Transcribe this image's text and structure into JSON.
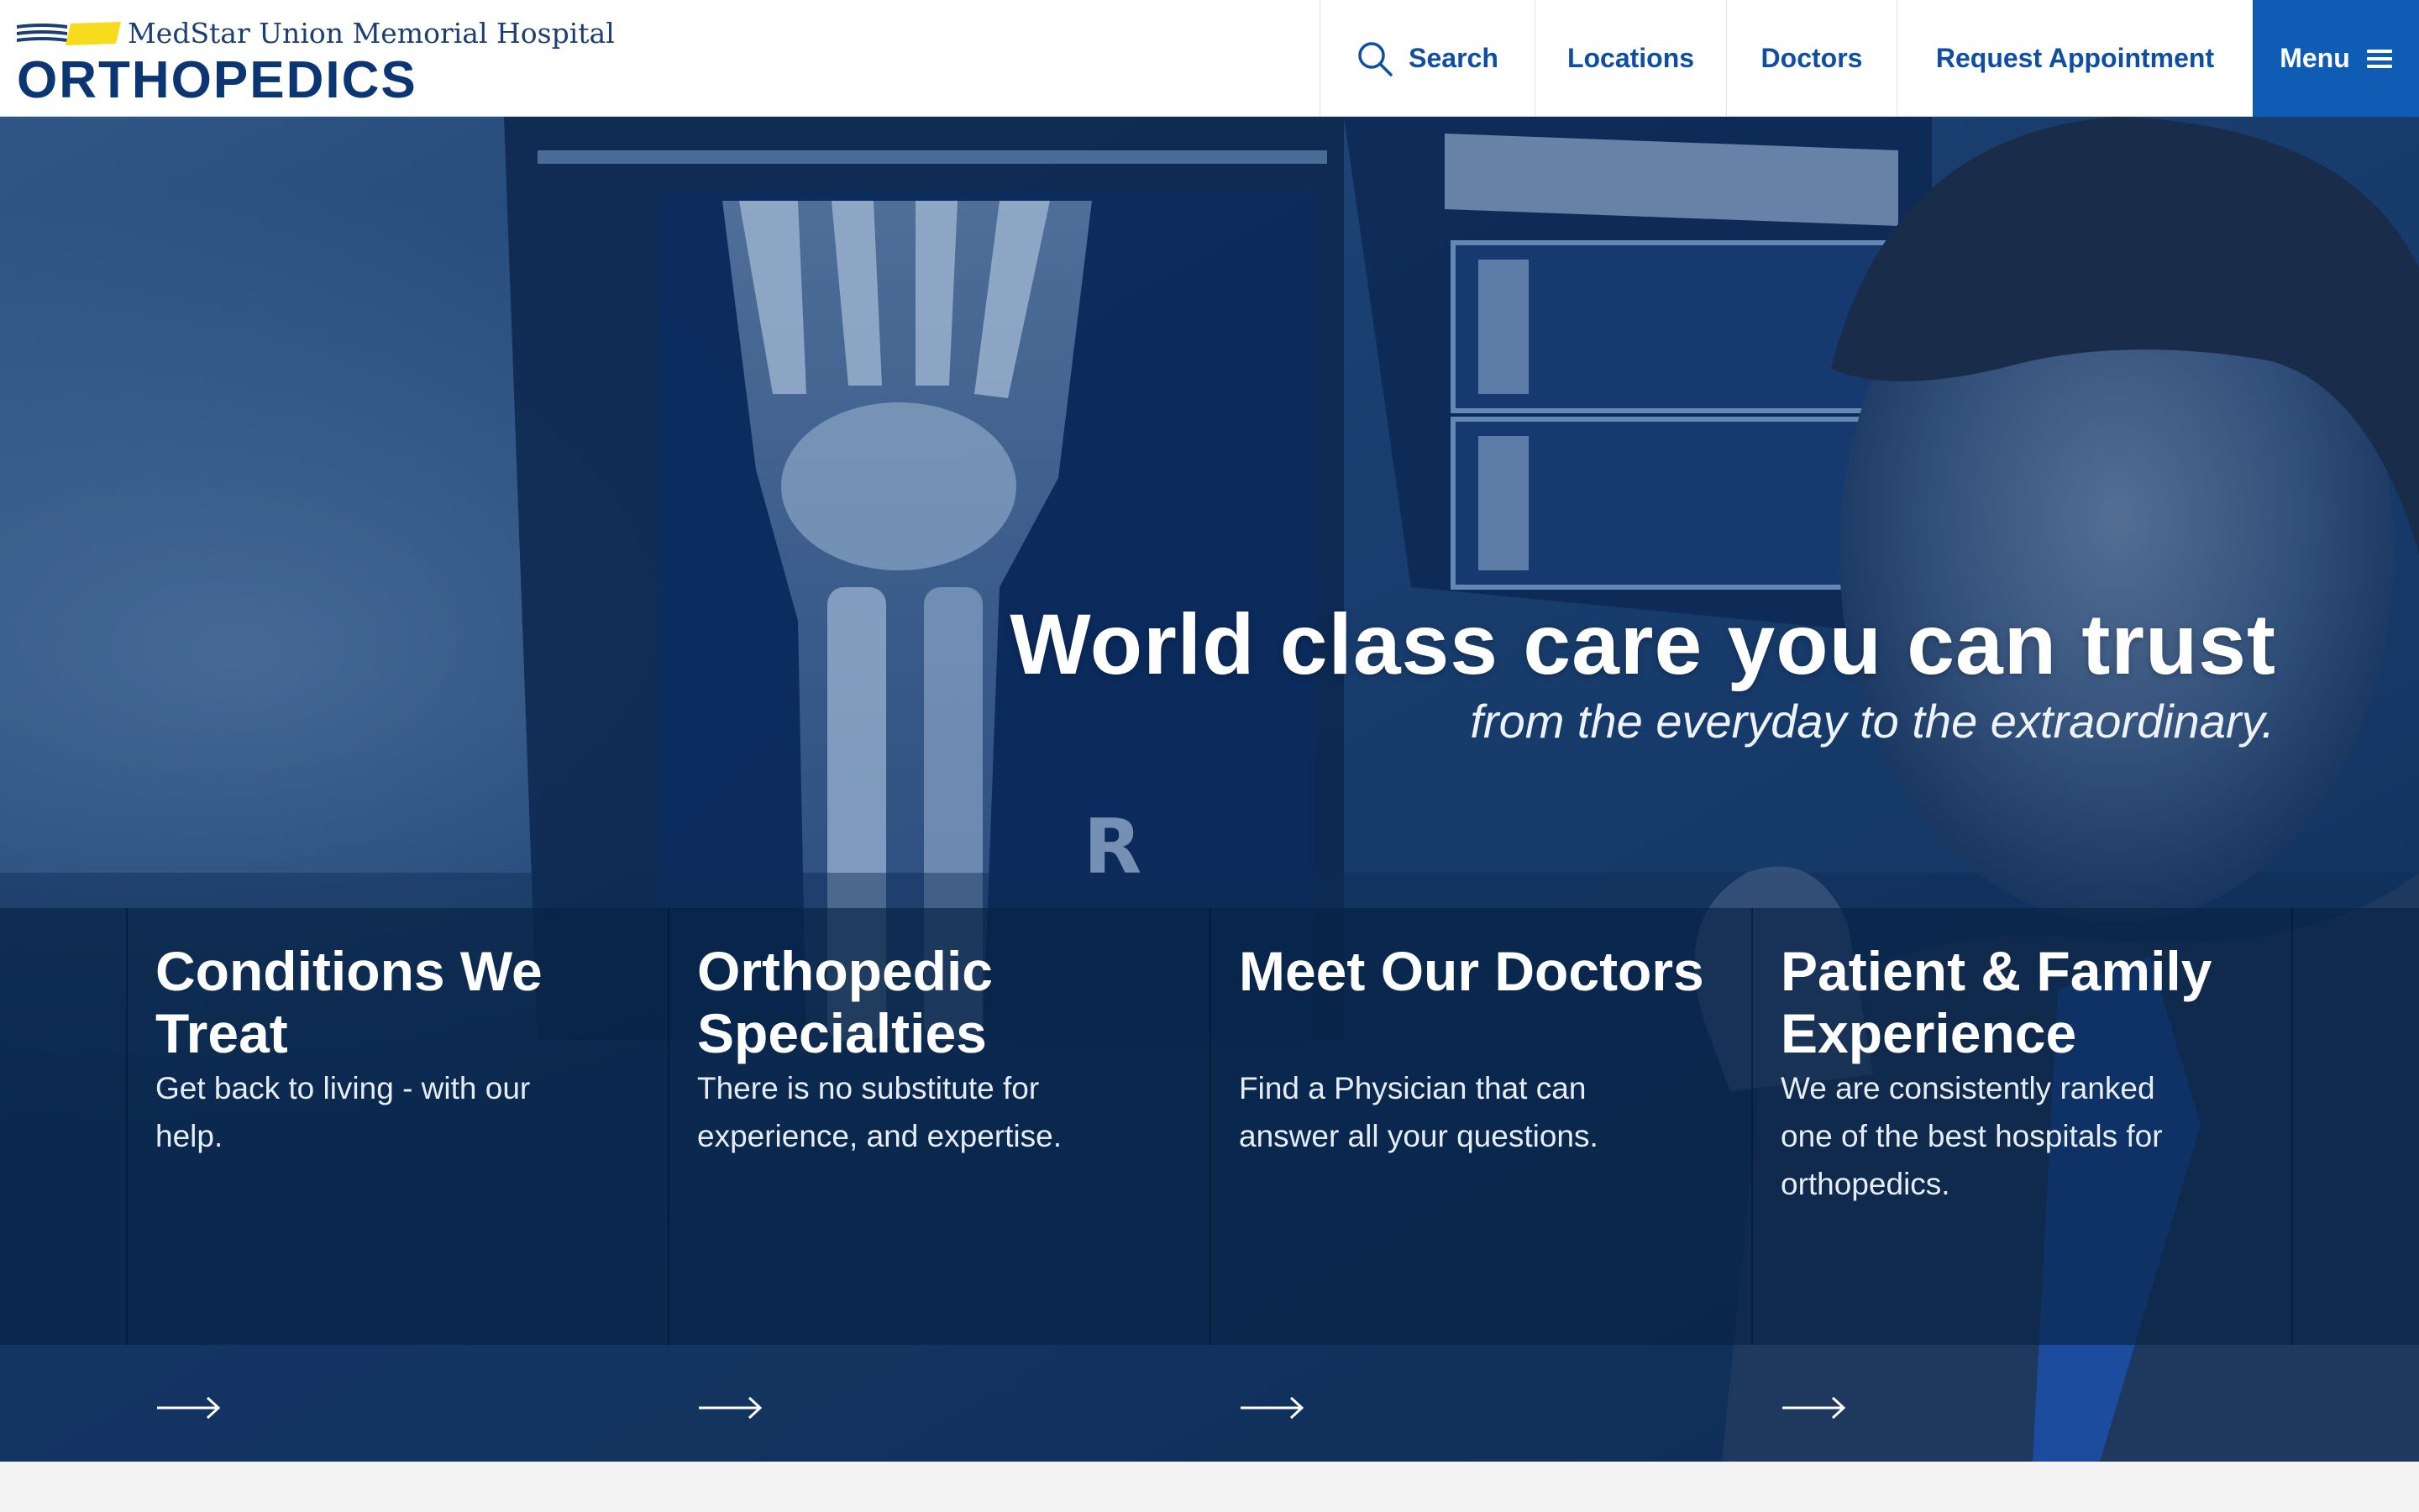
{
  "header": {
    "hospital_name": "MedStar Union Memorial Hospital",
    "department": "ORTHOPEDICS",
    "logo_icon": "medstar-logo-icon"
  },
  "nav": {
    "search_label": "Search",
    "locations_label": "Locations",
    "doctors_label": "Doctors",
    "request_label": "Request Appointment",
    "menu_label": "Menu"
  },
  "hero": {
    "headline": "World class care you can trust",
    "subheadline": "from the everyday to the extraordinary."
  },
  "cards": [
    {
      "title": "Conditions We Treat",
      "description": "Get back to living - with our help."
    },
    {
      "title": "Orthopedic Specialties",
      "description": "There is no substitute for experience, and expertise."
    },
    {
      "title": "Meet Our Doctors",
      "description": "Find a Physician that can answer all your questions."
    },
    {
      "title": "Patient & Family Experience",
      "description": "We are consistently ranked one of the best hospitals for orthopedics."
    }
  ],
  "colors": {
    "brand_navy": "#0b3573",
    "link_blue": "#0e4fa3",
    "menu_blue": "#0e5cb4",
    "accent_yellow": "#f6dc1c",
    "hero_overlay": "#12325c"
  },
  "icons": {
    "search": "search-icon",
    "menu": "hamburger-icon",
    "card_arrow": "arrow-right-icon"
  }
}
